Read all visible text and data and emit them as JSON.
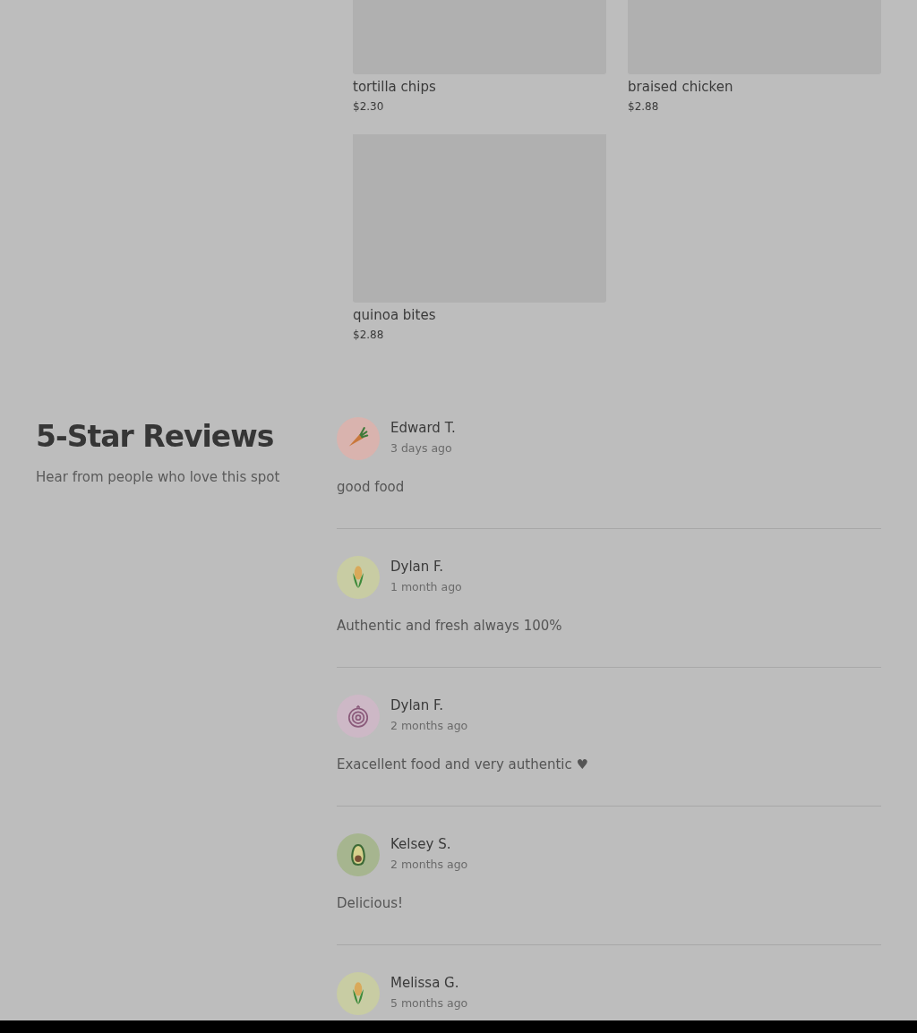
{
  "products": [
    {
      "name": "tortilla chips",
      "price": "$2.30",
      "cut": true
    },
    {
      "name": "braised chicken",
      "price": "$2.88",
      "cut": true
    },
    {
      "name": "quinoa bites",
      "price": "$2.88",
      "cut": false
    }
  ],
  "reviews_section": {
    "title": "5-Star Reviews",
    "subtitle": "Hear from people who love this spot"
  },
  "reviews": [
    {
      "kind": "carrot",
      "name": "Edward T.",
      "time": "3 days ago",
      "text": "good food"
    },
    {
      "kind": "corn",
      "name": "Dylan F.",
      "time": "1 month ago",
      "text": "Authentic and fresh always 100%"
    },
    {
      "kind": "onion",
      "name": "Dylan F.",
      "time": "2 months ago",
      "text": "Exacellent food and very authentic ♥"
    },
    {
      "kind": "avocado",
      "name": "Kelsey S.",
      "time": "2 months ago",
      "text": "Delicious!"
    },
    {
      "kind": "corn",
      "name": "Melissa G.",
      "time": "5 months ago"
    }
  ]
}
